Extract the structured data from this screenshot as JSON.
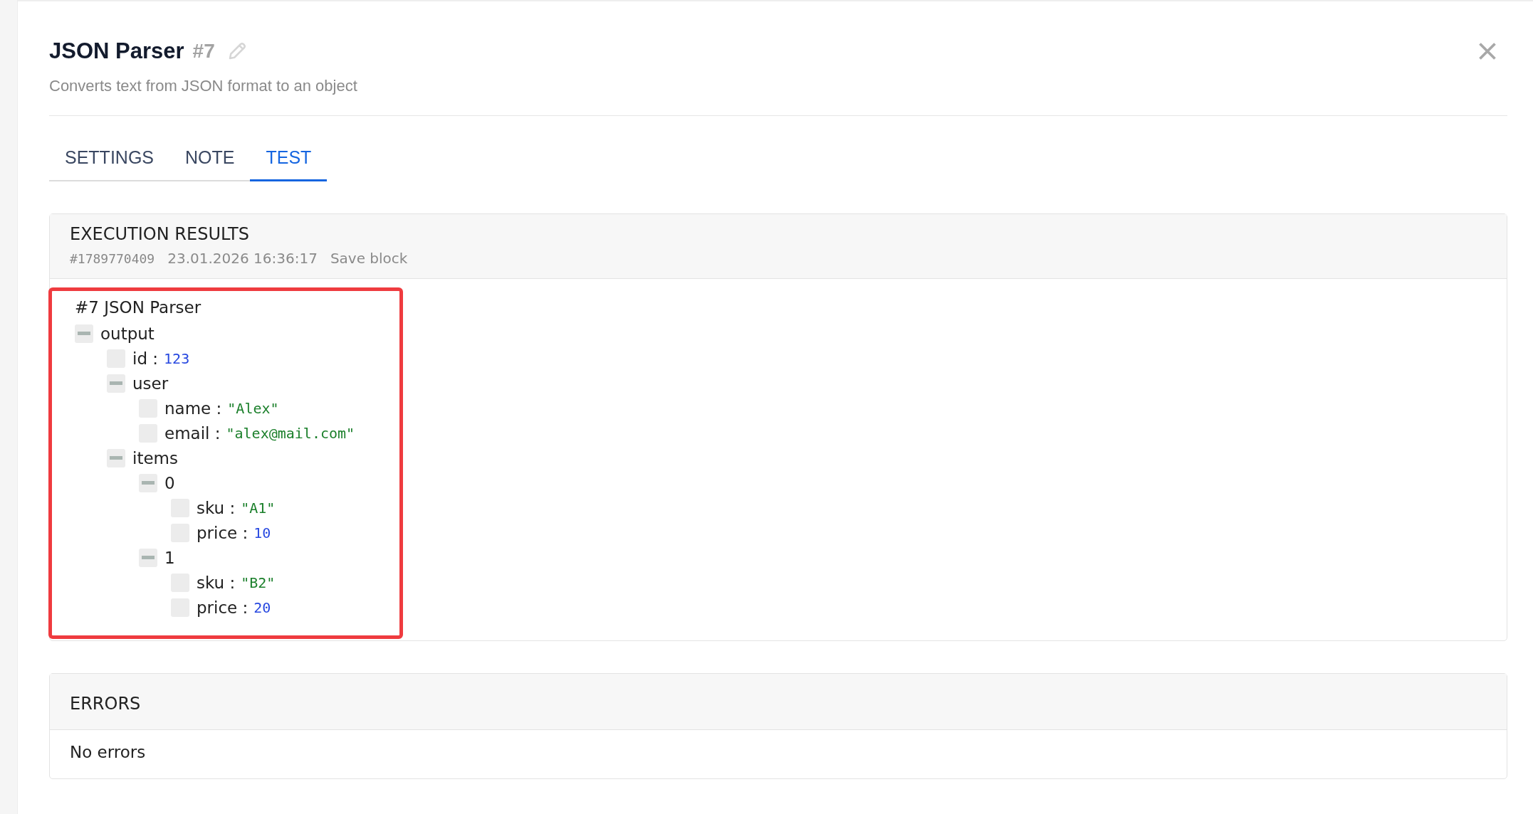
{
  "header": {
    "title": "JSON Parser",
    "number": "#7",
    "subtitle": "Converts text from JSON format to an object"
  },
  "tabs": [
    {
      "label": "SETTINGS",
      "selected": false
    },
    {
      "label": "NOTE",
      "selected": false
    },
    {
      "label": "TEST",
      "selected": true
    }
  ],
  "results": {
    "title": "EXECUTION RESULTS",
    "run_id": "#1789770409",
    "timestamp": "23.01.2026 16:36:17",
    "save_link": "Save block"
  },
  "result": {
    "highlighted": true,
    "block_title": "#7 JSON Parser",
    "tree": [
      {
        "kind": "object",
        "label": "output",
        "expanded": true,
        "children": [
          {
            "kind": "number",
            "label": "id :",
            "value": "123"
          },
          {
            "kind": "object",
            "label": "user",
            "expanded": true,
            "children": [
              {
                "kind": "string",
                "label": "name :",
                "value": "\"Alex\""
              },
              {
                "kind": "string",
                "label": "email :",
                "value": "\"alex@mail.com\""
              }
            ]
          },
          {
            "kind": "object",
            "label": "items",
            "expanded": true,
            "children": [
              {
                "kind": "object",
                "label": "0",
                "expanded": true,
                "children": [
                  {
                    "kind": "string",
                    "label": "sku :",
                    "value": "\"A1\""
                  },
                  {
                    "kind": "number",
                    "label": "price :",
                    "value": "10"
                  }
                ]
              },
              {
                "kind": "object",
                "label": "1",
                "expanded": true,
                "children": [
                  {
                    "kind": "string",
                    "label": "sku :",
                    "value": "\"B2\""
                  },
                  {
                    "kind": "number",
                    "label": "price :",
                    "value": "20"
                  }
                ]
              }
            ]
          }
        ]
      }
    ]
  },
  "errors": {
    "title": "ERRORS",
    "message": "No errors"
  }
}
